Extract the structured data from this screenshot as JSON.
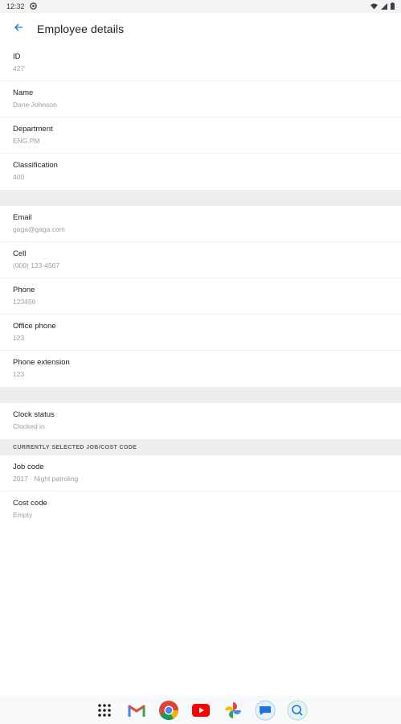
{
  "status_bar": {
    "time": "12:32"
  },
  "app_bar": {
    "title": "Employee details"
  },
  "group1": [
    {
      "label": "ID",
      "value": "427"
    },
    {
      "label": "Name",
      "value": "Dane Johnson"
    },
    {
      "label": "Department",
      "value": "ENG.PM"
    },
    {
      "label": "Classification",
      "value": "400"
    }
  ],
  "group2": [
    {
      "label": "Email",
      "value": "gaga@gaga.com"
    },
    {
      "label": "Cell",
      "value": "(000) 123-4567"
    },
    {
      "label": "Phone",
      "value": "123456"
    },
    {
      "label": "Office phone",
      "value": "123"
    },
    {
      "label": "Phone extension",
      "value": "123"
    }
  ],
  "clock": {
    "label": "Clock status",
    "value": "Clocked in"
  },
  "section_header": "CURRENTLY SELECTED JOB/COST CODE",
  "group3": [
    {
      "label": "Job code",
      "value": "2017 · Night patroling"
    },
    {
      "label": "Cost code",
      "value": "Empty"
    }
  ],
  "dock_apps": [
    "app-drawer-icon",
    "gmail-icon",
    "chrome-icon",
    "youtube-icon",
    "photos-icon",
    "messages-icon",
    "assistant-icon"
  ],
  "colors": {
    "accent": "#1a73e8",
    "divider": "#eeeeee",
    "secondary_text": "#9aa0a6"
  }
}
